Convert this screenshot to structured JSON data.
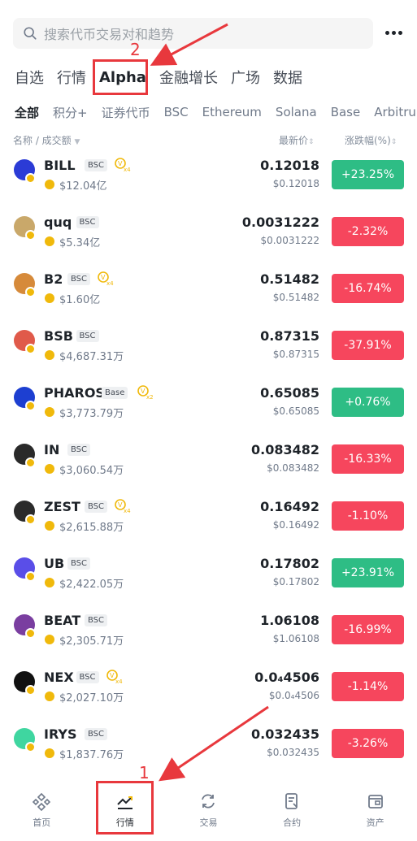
{
  "search": {
    "placeholder": "搜索代币交易对和趋势"
  },
  "main_tabs": [
    {
      "label": "自选",
      "active": false
    },
    {
      "label": "行情",
      "active": false
    },
    {
      "label": "Alpha",
      "active": true
    },
    {
      "label": "金融增长",
      "active": false
    },
    {
      "label": "广场",
      "active": false
    },
    {
      "label": "数据",
      "active": false
    }
  ],
  "sub_tabs": [
    {
      "label": "全部",
      "active": true
    },
    {
      "label": "积分+",
      "active": false
    },
    {
      "label": "证券代币",
      "active": false
    },
    {
      "label": "BSC",
      "active": false
    },
    {
      "label": "Ethereum",
      "active": false
    },
    {
      "label": "Solana",
      "active": false
    },
    {
      "label": "Base",
      "active": false
    },
    {
      "label": "Arbitru",
      "active": false
    }
  ],
  "header": {
    "name_volume": "名称 / 成交额",
    "last_price": "最新价",
    "change_pct": "涨跌幅(%)"
  },
  "rows": [
    {
      "symbol": "BILL",
      "chain": "BSC",
      "multiplier": "x4",
      "volume": "$12.04亿",
      "price": "0.12018",
      "fiat": "$0.12018",
      "change": "+23.25%",
      "dir": "up",
      "logo_color": "#2b3bd6"
    },
    {
      "symbol": "quq",
      "chain": "BSC",
      "multiplier": "",
      "volume": "$5.34亿",
      "price": "0.0031222",
      "fiat": "$0.0031222",
      "change": "-2.32%",
      "dir": "down",
      "logo_color": "#c9a86a"
    },
    {
      "symbol": "B2",
      "chain": "BSC",
      "multiplier": "x4",
      "volume": "$1.60亿",
      "price": "0.51482",
      "fiat": "$0.51482",
      "change": "-16.74%",
      "dir": "down",
      "logo_color": "#d68a3a"
    },
    {
      "symbol": "BSB",
      "chain": "BSC",
      "multiplier": "",
      "volume": "$4,687.31万",
      "price": "0.87315",
      "fiat": "$0.87315",
      "change": "-37.91%",
      "dir": "down",
      "logo_color": "#e05a4a"
    },
    {
      "symbol": "PHAROS",
      "chain": "Base",
      "multiplier": "x2",
      "volume": "$3,773.79万",
      "price": "0.65085",
      "fiat": "$0.65085",
      "change": "+0.76%",
      "dir": "up",
      "logo_color": "#1d3fd1"
    },
    {
      "symbol": "IN",
      "chain": "BSC",
      "multiplier": "",
      "volume": "$3,060.54万",
      "price": "0.083482",
      "fiat": "$0.083482",
      "change": "-16.33%",
      "dir": "down",
      "logo_color": "#2a2a2a"
    },
    {
      "symbol": "ZEST",
      "chain": "BSC",
      "multiplier": "x4",
      "volume": "$2,615.88万",
      "price": "0.16492",
      "fiat": "$0.16492",
      "change": "-1.10%",
      "dir": "down",
      "logo_color": "#2b2b2b"
    },
    {
      "symbol": "UB",
      "chain": "BSC",
      "multiplier": "",
      "volume": "$2,422.05万",
      "price": "0.17802",
      "fiat": "$0.17802",
      "change": "+23.91%",
      "dir": "up",
      "logo_color": "#5a4ee8"
    },
    {
      "symbol": "BEAT",
      "chain": "BSC",
      "multiplier": "",
      "volume": "$2,305.71万",
      "price": "1.06108",
      "fiat": "$1.06108",
      "change": "-16.99%",
      "dir": "down",
      "logo_color": "#7a3ea0"
    },
    {
      "symbol": "NEX",
      "chain": "BSC",
      "multiplier": "x4",
      "volume": "$2,027.10万",
      "price": "0.0₄4506",
      "fiat": "$0.0₄4506",
      "change": "-1.14%",
      "dir": "down",
      "logo_color": "#111111"
    },
    {
      "symbol": "IRYS",
      "chain": "BSC",
      "multiplier": "",
      "volume": "$1,837.76万",
      "price": "0.032435",
      "fiat": "$0.032435",
      "change": "-3.26%",
      "dir": "down",
      "logo_color": "#3fd6a0"
    }
  ],
  "bottom_nav": [
    {
      "label": "首页",
      "icon": "home-icon",
      "active": false
    },
    {
      "label": "行情",
      "icon": "markets-icon",
      "active": true
    },
    {
      "label": "交易",
      "icon": "trade-icon",
      "active": false
    },
    {
      "label": "合约",
      "icon": "futures-icon",
      "active": false
    },
    {
      "label": "资产",
      "icon": "wallet-icon",
      "active": false
    }
  ],
  "annotations": {
    "step1": "1",
    "step2": "2"
  },
  "colors": {
    "up": "#2ebd85",
    "down": "#f6465d",
    "annotation": "#e8383d",
    "brand": "#f0b90b"
  }
}
